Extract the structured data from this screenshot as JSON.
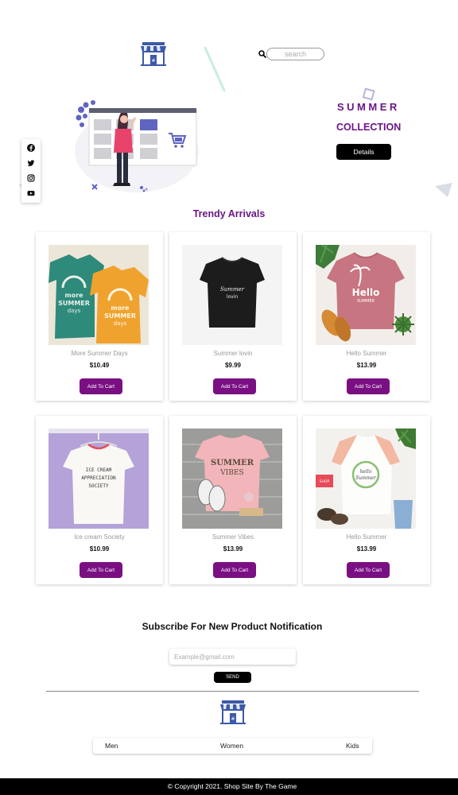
{
  "header": {
    "logo_icon": "store-icon",
    "search": {
      "placeholder": "search",
      "icon": "search-icon"
    }
  },
  "hero": {
    "title_line1": "SUMMER",
    "title_line2": "COLLECTION",
    "details_label": "Details",
    "illustration": "woman-shopping-online-illustration"
  },
  "social": [
    "facebook-icon",
    "twitter-icon",
    "instagram-icon",
    "youtube-icon"
  ],
  "products_section": {
    "title": "Trendy Arrivals",
    "cart_label": "Add To Cart",
    "products": [
      {
        "name": "More Summer Days",
        "price": "$10.49",
        "image": "teal-and-orange-sun-tees"
      },
      {
        "name": "Summer lovin",
        "price": "$9.99",
        "image": "black-script-tee"
      },
      {
        "name": "Hello Summer",
        "price": "$13.99",
        "image": "pink-palm-tree-tee"
      },
      {
        "name": "Ice cream Society",
        "price": "$10.99",
        "image": "white-tee-on-hanger"
      },
      {
        "name": "Summer Vibes",
        "price": "$13.99",
        "image": "pink-summer-vibes-tee"
      },
      {
        "name": "Hello Summer",
        "price": "$13.99",
        "image": "raglan-hello-summer-tee"
      }
    ]
  },
  "subscribe": {
    "title": "Subscribe For New Product Notification",
    "email_placeholder": "Example@gmail.com",
    "send_label": "SEND"
  },
  "footer": {
    "logo_icon": "store-icon",
    "nav": [
      "Men",
      "Women",
      "Kids"
    ],
    "copyright": "© Copyright 2021. Shop Site By The Game"
  },
  "colors": {
    "accent": "#7a0f83",
    "title_purple": "#6b1686",
    "store_blue": "#3c5aa6",
    "dark": "#000000"
  }
}
